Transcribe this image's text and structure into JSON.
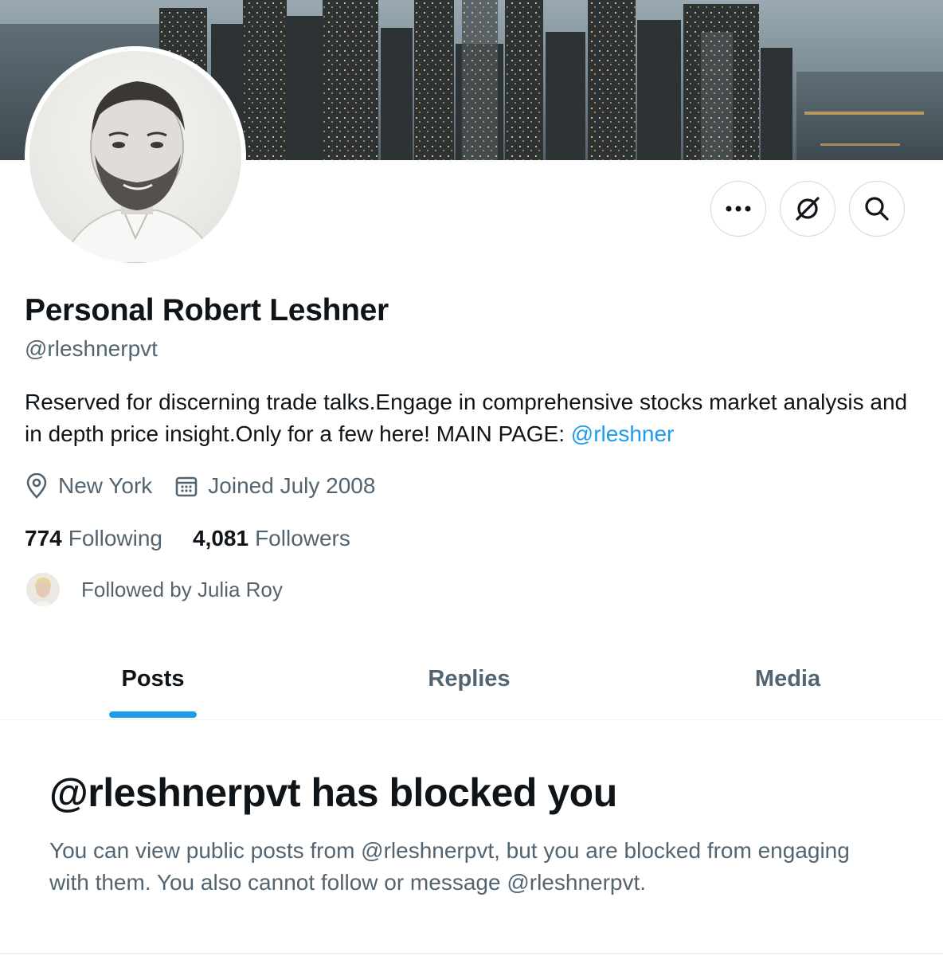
{
  "profile": {
    "display_name": "Personal Robert Leshner",
    "handle": "@rleshnerpvt",
    "bio_text": "Reserved for discerning trade talks.Engage in comprehensive stocks market analysis and in depth price insight.Only for a few here! MAIN PAGE: ",
    "bio_link": "@rleshner",
    "location": "New York",
    "joined": "Joined July 2008",
    "following_count": "774",
    "following_label": "Following",
    "followers_count": "4,081",
    "followers_label": "Followers",
    "followed_by": "Followed by Julia Roy"
  },
  "actions": {
    "more_icon": "more-icon",
    "grok_icon": "grok-icon",
    "search_icon": "search-icon"
  },
  "tabs": [
    {
      "label": "Posts",
      "selected": true
    },
    {
      "label": "Replies",
      "selected": false
    },
    {
      "label": "Media",
      "selected": false
    }
  ],
  "blocked": {
    "title": "@rleshnerpvt has blocked you",
    "message": "You can view public posts from @rleshnerpvt, but you are blocked from engaging with them. You also cannot follow or message @rleshnerpvt."
  },
  "colors": {
    "accent": "#1d9bf0",
    "secondary_text": "#536471",
    "primary_text": "#0f1419",
    "border": "#cfd9de"
  }
}
